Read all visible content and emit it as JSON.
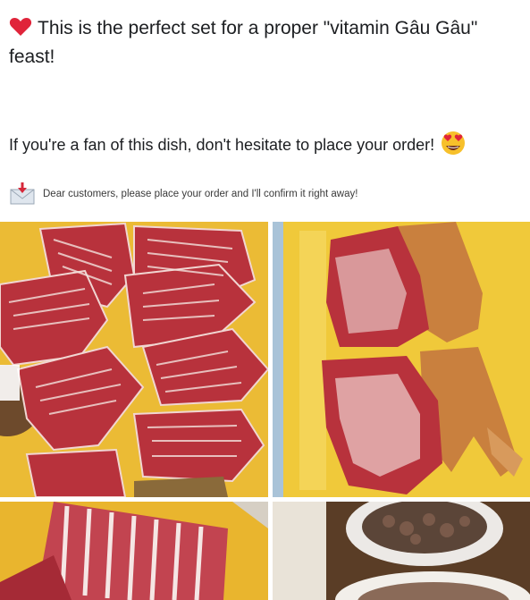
{
  "post": {
    "line1": "This is the perfect set for a proper \"vitamin Gâu Gâu\" feast!",
    "line2": "If you're a fan of this dish, don't hesitate to place your order!",
    "line3": "Dear customers, please place your order and I'll confirm it right away!"
  },
  "icons": {
    "line1": "red-heart-icon",
    "line2": "heart-eyes-emoji-icon",
    "line3": "envelope-with-arrow-icon"
  },
  "photos": [
    {
      "name": "photo-raw-meat-ribs-on-yellow-board"
    },
    {
      "name": "photo-two-roasted-halves-on-yellow-board"
    },
    {
      "name": "photo-rib-rack-closeup"
    },
    {
      "name": "photo-bowls-of-food"
    }
  ],
  "colors": {
    "text": "#1c1e21",
    "heart": "#e0243a",
    "board_yellow": "#f2c12e",
    "meat_red": "#b8323c",
    "roast_brown": "#c9803e"
  }
}
